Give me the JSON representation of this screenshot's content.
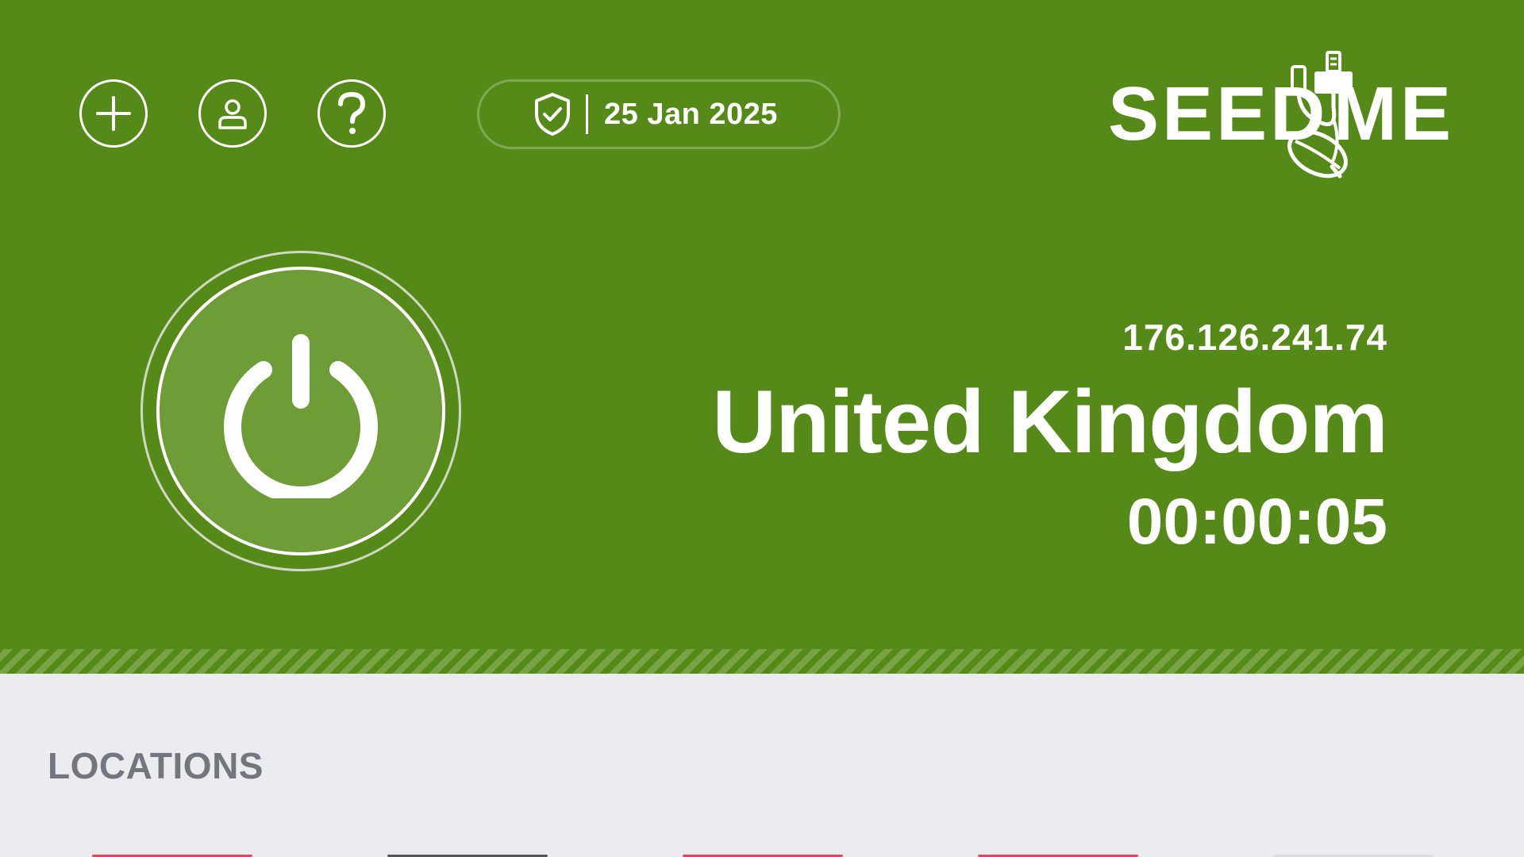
{
  "toolbar": {
    "add_icon": "plus-icon",
    "account_icon": "user-icon",
    "help_icon": "question-icon"
  },
  "status": {
    "icon": "shield-check-icon",
    "date": "25 Jan 2025"
  },
  "logo": {
    "text_left": "SEED",
    "text_right": "ME",
    "icon": "seed-cable-icon"
  },
  "connection": {
    "power_icon": "power-icon",
    "ip": "176.126.241.74",
    "country": "United Kingdom",
    "duration": "00:00:05"
  },
  "locations": {
    "label": "LOCATIONS",
    "cards": [
      {
        "accent": "#d94b5c"
      },
      {
        "accent": "#555555"
      },
      {
        "accent": "#d94b5c"
      },
      {
        "accent": "#d94b5c"
      },
      {
        "accent": "#dddddd"
      }
    ]
  },
  "colors": {
    "primary_green": "#568a18",
    "power_fill": "#6e9c36",
    "background": "#ebebf0",
    "label_gray": "#757580"
  }
}
